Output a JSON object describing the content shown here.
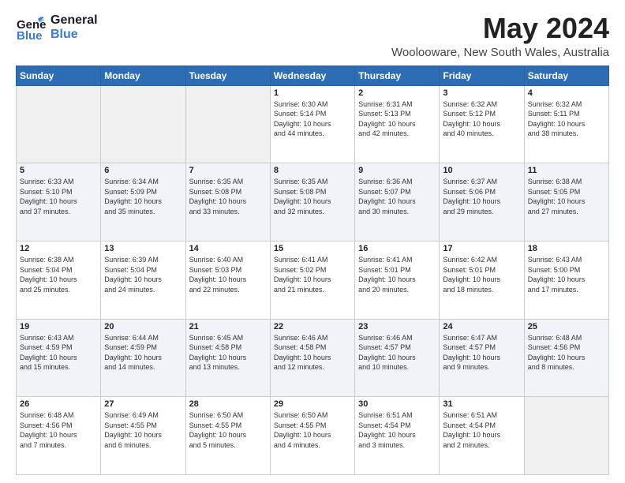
{
  "header": {
    "logo_general": "General",
    "logo_blue": "Blue",
    "title": "May 2024",
    "subtitle": "Woolooware, New South Wales, Australia"
  },
  "weekdays": [
    "Sunday",
    "Monday",
    "Tuesday",
    "Wednesday",
    "Thursday",
    "Friday",
    "Saturday"
  ],
  "weeks": [
    [
      {
        "num": "",
        "info": ""
      },
      {
        "num": "",
        "info": ""
      },
      {
        "num": "",
        "info": ""
      },
      {
        "num": "1",
        "info": "Sunrise: 6:30 AM\nSunset: 5:14 PM\nDaylight: 10 hours\nand 44 minutes."
      },
      {
        "num": "2",
        "info": "Sunrise: 6:31 AM\nSunset: 5:13 PM\nDaylight: 10 hours\nand 42 minutes."
      },
      {
        "num": "3",
        "info": "Sunrise: 6:32 AM\nSunset: 5:12 PM\nDaylight: 10 hours\nand 40 minutes."
      },
      {
        "num": "4",
        "info": "Sunrise: 6:32 AM\nSunset: 5:11 PM\nDaylight: 10 hours\nand 38 minutes."
      }
    ],
    [
      {
        "num": "5",
        "info": "Sunrise: 6:33 AM\nSunset: 5:10 PM\nDaylight: 10 hours\nand 37 minutes."
      },
      {
        "num": "6",
        "info": "Sunrise: 6:34 AM\nSunset: 5:09 PM\nDaylight: 10 hours\nand 35 minutes."
      },
      {
        "num": "7",
        "info": "Sunrise: 6:35 AM\nSunset: 5:08 PM\nDaylight: 10 hours\nand 33 minutes."
      },
      {
        "num": "8",
        "info": "Sunrise: 6:35 AM\nSunset: 5:08 PM\nDaylight: 10 hours\nand 32 minutes."
      },
      {
        "num": "9",
        "info": "Sunrise: 6:36 AM\nSunset: 5:07 PM\nDaylight: 10 hours\nand 30 minutes."
      },
      {
        "num": "10",
        "info": "Sunrise: 6:37 AM\nSunset: 5:06 PM\nDaylight: 10 hours\nand 29 minutes."
      },
      {
        "num": "11",
        "info": "Sunrise: 6:38 AM\nSunset: 5:05 PM\nDaylight: 10 hours\nand 27 minutes."
      }
    ],
    [
      {
        "num": "12",
        "info": "Sunrise: 6:38 AM\nSunset: 5:04 PM\nDaylight: 10 hours\nand 25 minutes."
      },
      {
        "num": "13",
        "info": "Sunrise: 6:39 AM\nSunset: 5:04 PM\nDaylight: 10 hours\nand 24 minutes."
      },
      {
        "num": "14",
        "info": "Sunrise: 6:40 AM\nSunset: 5:03 PM\nDaylight: 10 hours\nand 22 minutes."
      },
      {
        "num": "15",
        "info": "Sunrise: 6:41 AM\nSunset: 5:02 PM\nDaylight: 10 hours\nand 21 minutes."
      },
      {
        "num": "16",
        "info": "Sunrise: 6:41 AM\nSunset: 5:01 PM\nDaylight: 10 hours\nand 20 minutes."
      },
      {
        "num": "17",
        "info": "Sunrise: 6:42 AM\nSunset: 5:01 PM\nDaylight: 10 hours\nand 18 minutes."
      },
      {
        "num": "18",
        "info": "Sunrise: 6:43 AM\nSunset: 5:00 PM\nDaylight: 10 hours\nand 17 minutes."
      }
    ],
    [
      {
        "num": "19",
        "info": "Sunrise: 6:43 AM\nSunset: 4:59 PM\nDaylight: 10 hours\nand 15 minutes."
      },
      {
        "num": "20",
        "info": "Sunrise: 6:44 AM\nSunset: 4:59 PM\nDaylight: 10 hours\nand 14 minutes."
      },
      {
        "num": "21",
        "info": "Sunrise: 6:45 AM\nSunset: 4:58 PM\nDaylight: 10 hours\nand 13 minutes."
      },
      {
        "num": "22",
        "info": "Sunrise: 6:46 AM\nSunset: 4:58 PM\nDaylight: 10 hours\nand 12 minutes."
      },
      {
        "num": "23",
        "info": "Sunrise: 6:46 AM\nSunset: 4:57 PM\nDaylight: 10 hours\nand 10 minutes."
      },
      {
        "num": "24",
        "info": "Sunrise: 6:47 AM\nSunset: 4:57 PM\nDaylight: 10 hours\nand 9 minutes."
      },
      {
        "num": "25",
        "info": "Sunrise: 6:48 AM\nSunset: 4:56 PM\nDaylight: 10 hours\nand 8 minutes."
      }
    ],
    [
      {
        "num": "26",
        "info": "Sunrise: 6:48 AM\nSunset: 4:56 PM\nDaylight: 10 hours\nand 7 minutes."
      },
      {
        "num": "27",
        "info": "Sunrise: 6:49 AM\nSunset: 4:55 PM\nDaylight: 10 hours\nand 6 minutes."
      },
      {
        "num": "28",
        "info": "Sunrise: 6:50 AM\nSunset: 4:55 PM\nDaylight: 10 hours\nand 5 minutes."
      },
      {
        "num": "29",
        "info": "Sunrise: 6:50 AM\nSunset: 4:55 PM\nDaylight: 10 hours\nand 4 minutes."
      },
      {
        "num": "30",
        "info": "Sunrise: 6:51 AM\nSunset: 4:54 PM\nDaylight: 10 hours\nand 3 minutes."
      },
      {
        "num": "31",
        "info": "Sunrise: 6:51 AM\nSunset: 4:54 PM\nDaylight: 10 hours\nand 2 minutes."
      },
      {
        "num": "",
        "info": ""
      }
    ]
  ]
}
